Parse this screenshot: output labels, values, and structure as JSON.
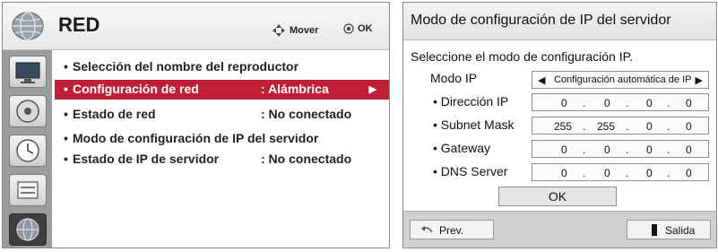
{
  "left": {
    "title": "RED",
    "hints": {
      "move": "Mover",
      "ok": "OK"
    },
    "icons": [
      "globe-icon",
      "tv-icon",
      "disc-icon",
      "clock-icon",
      "tools-icon",
      "network-globe-icon"
    ],
    "menu": [
      {
        "label": "Selección del nombre del reproductor",
        "value": ""
      },
      {
        "label": "Configuración de red",
        "value": ": Alámbrica"
      },
      {
        "label": "Estado de red",
        "value": ": No conectado"
      },
      {
        "label": "Modo de configuración de IP del servidor",
        "value": ""
      },
      {
        "label": "Estado de IP de servidor",
        "value": ": No conectado"
      }
    ],
    "selected_index": 1,
    "accent_color": "#bf2035"
  },
  "dialog": {
    "title": "Modo de configuración de IP del servidor",
    "instruction": "Seleccione el modo de configuración IP.",
    "mode": {
      "label": "Modo IP",
      "value": "Configuración automática de IP"
    },
    "fields": [
      {
        "label": "• Dirección IP",
        "octets": [
          "0",
          "0",
          "0",
          "0"
        ]
      },
      {
        "label": "• Subnet Mask",
        "octets": [
          "255",
          "255",
          "0",
          "0"
        ]
      },
      {
        "label": "• Gateway",
        "octets": [
          "0",
          "0",
          "0",
          "0"
        ]
      },
      {
        "label": "• DNS Server",
        "octets": [
          "0",
          "0",
          "0",
          "0"
        ]
      }
    ],
    "ok_label": "OK",
    "prev_label": "Prev.",
    "exit_label": "Salida"
  }
}
